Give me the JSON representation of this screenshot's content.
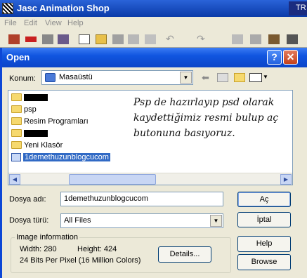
{
  "app": {
    "title": "Jasc Animation Shop",
    "corner_text": "TR"
  },
  "menu": [
    "File",
    "Edit",
    "View",
    "Help"
  ],
  "dialog": {
    "title": "Open",
    "look_in_label": "Konum:",
    "look_in_value": "Masaüstü",
    "files": [
      {
        "name": "",
        "type": "folder-redacted"
      },
      {
        "name": "psp",
        "type": "folder"
      },
      {
        "name": "Resim Programları",
        "type": "folder"
      },
      {
        "name": "",
        "type": "folder-redacted"
      },
      {
        "name": "Yeni Klasör",
        "type": "folder"
      },
      {
        "name": "1demethuzunblogcucom",
        "type": "psd-file",
        "selected": true
      }
    ],
    "note_lines": [
      "Psp de hazırlayıp psd olarak",
      "kaydettiğimiz resmi bulup aç",
      "butonuna basıyoruz."
    ],
    "filename_label": "Dosya adı:",
    "filename_value": "1demethuzunblogcucom",
    "filetype_label": "Dosya türü:",
    "filetype_value": "All Files",
    "open_button": "Aç",
    "cancel_button": "İptal",
    "help_button": "Help",
    "browse_button": "Browse",
    "details_button": "Details...",
    "image_info": {
      "legend": "Image information",
      "width_text": "Width: 280",
      "height_text": "Height: 424",
      "bits_text": "24 Bits Per Pixel (16 Million Colors)"
    }
  }
}
